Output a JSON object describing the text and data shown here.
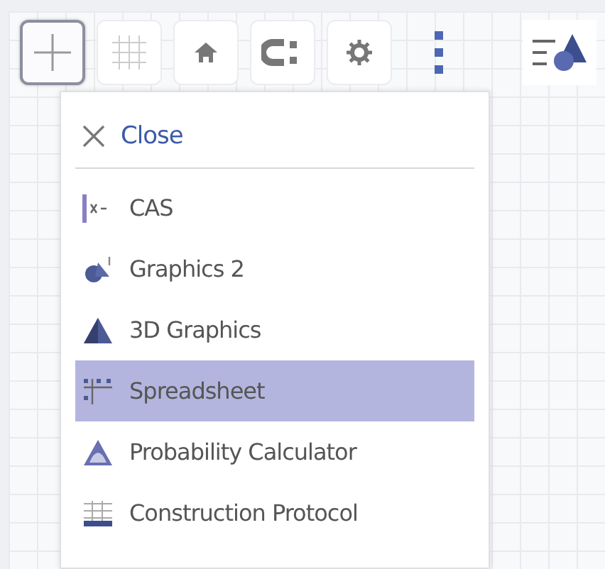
{
  "toolbar": [
    {
      "kind": "axes",
      "selected": true
    },
    {
      "kind": "grid",
      "selected": false
    },
    {
      "kind": "home",
      "selected": false
    },
    {
      "kind": "magnet",
      "selected": false
    },
    {
      "kind": "gear",
      "selected": false
    }
  ],
  "more_button": {
    "kind": "more"
  },
  "side_button": {
    "kind": "algebra"
  },
  "menu": {
    "close": "Close",
    "items": [
      {
        "kind": "cas",
        "label": "CAS",
        "selected": false
      },
      {
        "kind": "graphics2",
        "label": "Graphics 2",
        "selected": false
      },
      {
        "kind": "graphics3d",
        "label": "3D Graphics",
        "selected": false
      },
      {
        "kind": "spreadsheet",
        "label": "Spreadsheet",
        "selected": true
      },
      {
        "kind": "probability",
        "label": "Probability Calculator",
        "selected": false
      },
      {
        "kind": "protocol",
        "label": "Construction Protocol",
        "selected": false
      }
    ]
  }
}
